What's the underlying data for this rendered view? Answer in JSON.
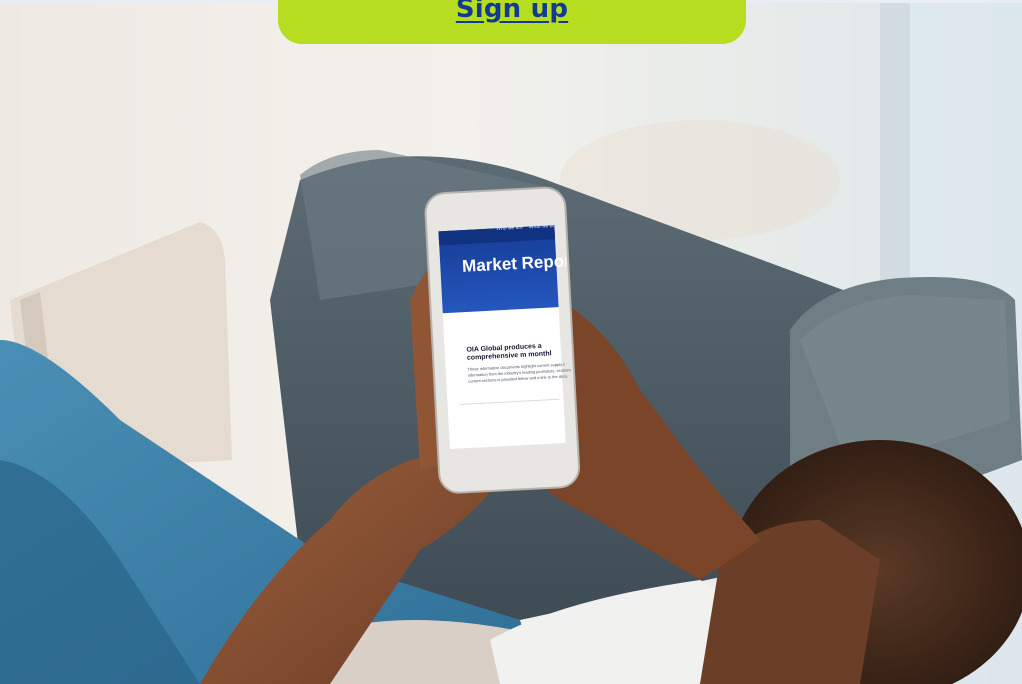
{
  "cta": {
    "signup_label": "Sign up"
  },
  "phone_screen": {
    "nav_items": [
      "Who we are",
      "What we do",
      "Indust"
    ],
    "title": "Market Report",
    "headline": "OIA Global produces a comprehensive m monthl",
    "body_lines": [
      "These informative documents highlight current supply c",
      "information from the industry's leading journalists, econom",
      "current sections is provided below and a link to the docu"
    ]
  },
  "colors": {
    "cta_background": "#b6dd1f",
    "cta_text": "#123a8e",
    "phone_brand_blue": "#1d4fb0"
  }
}
